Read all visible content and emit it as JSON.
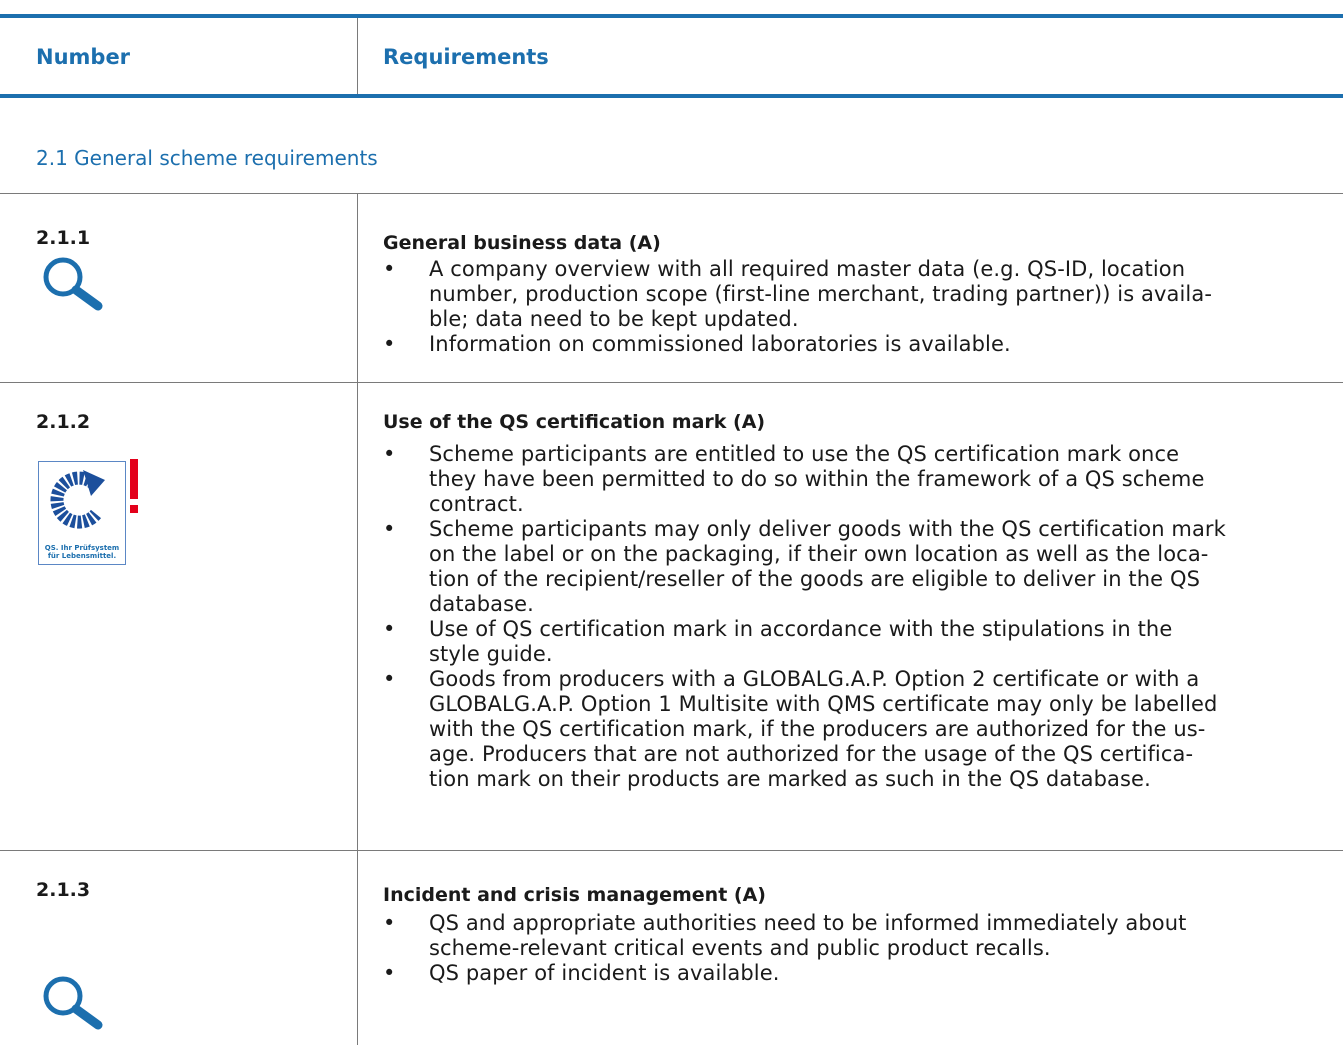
{
  "header": {
    "number_label": "Number",
    "requirements_label": "Requirements"
  },
  "section": {
    "title": "2.1 General scheme requirements"
  },
  "requirements": [
    {
      "number": "2.1.1",
      "title": "General business data (A)",
      "icon": "magnifier-icon",
      "bullets": [
        [
          "A company overview with all required master data (e.g. QS-ID, location",
          "number, production scope (first-line merchant, trading partner)) is availa-",
          "ble; data need to be kept updated."
        ],
        [
          "Information on commissioned laboratories is available."
        ]
      ]
    },
    {
      "number": "2.1.2",
      "title": "Use of the QS certification mark (A)",
      "icon": "qs-certification-mark-icon",
      "logo_text": "QS. Ihr Prüfsystem für Lebensmittel.",
      "bullets": [
        [
          "Scheme participants are entitled to use the QS certification mark once",
          "they have been permitted to do so within the framework of a QS scheme",
          "contract."
        ],
        [
          "Scheme participants may only deliver goods with the QS certification mark",
          "on the label or on the packaging, if their own location as well as the loca-",
          "tion of the recipient/reseller of the goods are eligible to deliver in the QS",
          "database."
        ],
        [
          "Use of QS certification mark in accordance with the stipulations in the",
          "style guide."
        ],
        [
          "Goods from producers with a GLOBALG.A.P. Option 2 certificate or with a",
          "GLOBALG.A.P. Option 1 Multisite with QMS certificate may only be labelled",
          "with the QS certification mark, if the producers are authorized for the us-",
          "age. Producers that are not authorized for the usage of the QS certifica-",
          "tion mark on their products are marked as such in the QS database."
        ]
      ]
    },
    {
      "number": "2.1.3",
      "title": "Incident and crisis management (A)",
      "icon": "magnifier-icon",
      "bullets": [
        [
          "QS and appropriate authorities need to be informed immediately about",
          "scheme-relevant critical events and public product recalls."
        ],
        [
          "QS paper of incident is available."
        ]
      ]
    }
  ],
  "colors": {
    "accent": "#1c6fae",
    "logo_blue": "#1c4f9c",
    "alert_red": "#e3001b",
    "rule_gray": "#7a7a7a"
  }
}
